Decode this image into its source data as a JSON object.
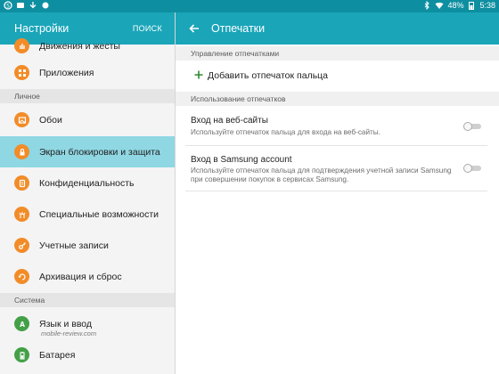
{
  "status_bar": {
    "battery": "48%",
    "time": "5:38"
  },
  "left_pane": {
    "title": "Настройки",
    "search_label": "ПОИСК",
    "items": [
      {
        "label": "Движения и жесты",
        "icon": "gesture-icon"
      },
      {
        "label": "Приложения",
        "icon": "apps-icon"
      },
      {
        "label": "Обои",
        "icon": "wallpaper-icon"
      },
      {
        "label": "Экран блокировки и защита",
        "icon": "lock-icon",
        "selected": true
      },
      {
        "label": "Конфиденциальность",
        "icon": "privacy-icon"
      },
      {
        "label": "Специальные возможности",
        "icon": "accessibility-icon"
      },
      {
        "label": "Учетные записи",
        "icon": "key-icon"
      },
      {
        "label": "Архивация и сброс",
        "icon": "backup-icon"
      },
      {
        "label": "Язык и ввод",
        "icon": "language-icon",
        "icon_color": "#43a047"
      },
      {
        "label": "Батарея",
        "icon": "battery-icon",
        "icon_color": "#43a047"
      }
    ],
    "sections": {
      "personal": "Личное",
      "system": "Система"
    }
  },
  "right_pane": {
    "title": "Отпечатки",
    "manage_section": "Управление отпечатками",
    "add_label": "Добавить отпечаток пальца",
    "usage_section": "Использование отпечатков",
    "options": [
      {
        "title": "Вход на веб-сайты",
        "desc": "Используйте отпечаток пальца для входа на веб-сайты.",
        "enabled": false
      },
      {
        "title": "Вход в Samsung account",
        "desc": "Используйте отпечаток пальца для подтверждения учетной записи Samsung при совершении покупок в сервисах Samsung.",
        "enabled": false
      }
    ]
  },
  "watermark": "mobile-review.com",
  "colors": {
    "header": "#1aa5b9",
    "status_bar": "#0e8fa1",
    "selected": "#8fd7e3",
    "icon_orange": "#f28c28",
    "icon_green": "#43a047"
  }
}
